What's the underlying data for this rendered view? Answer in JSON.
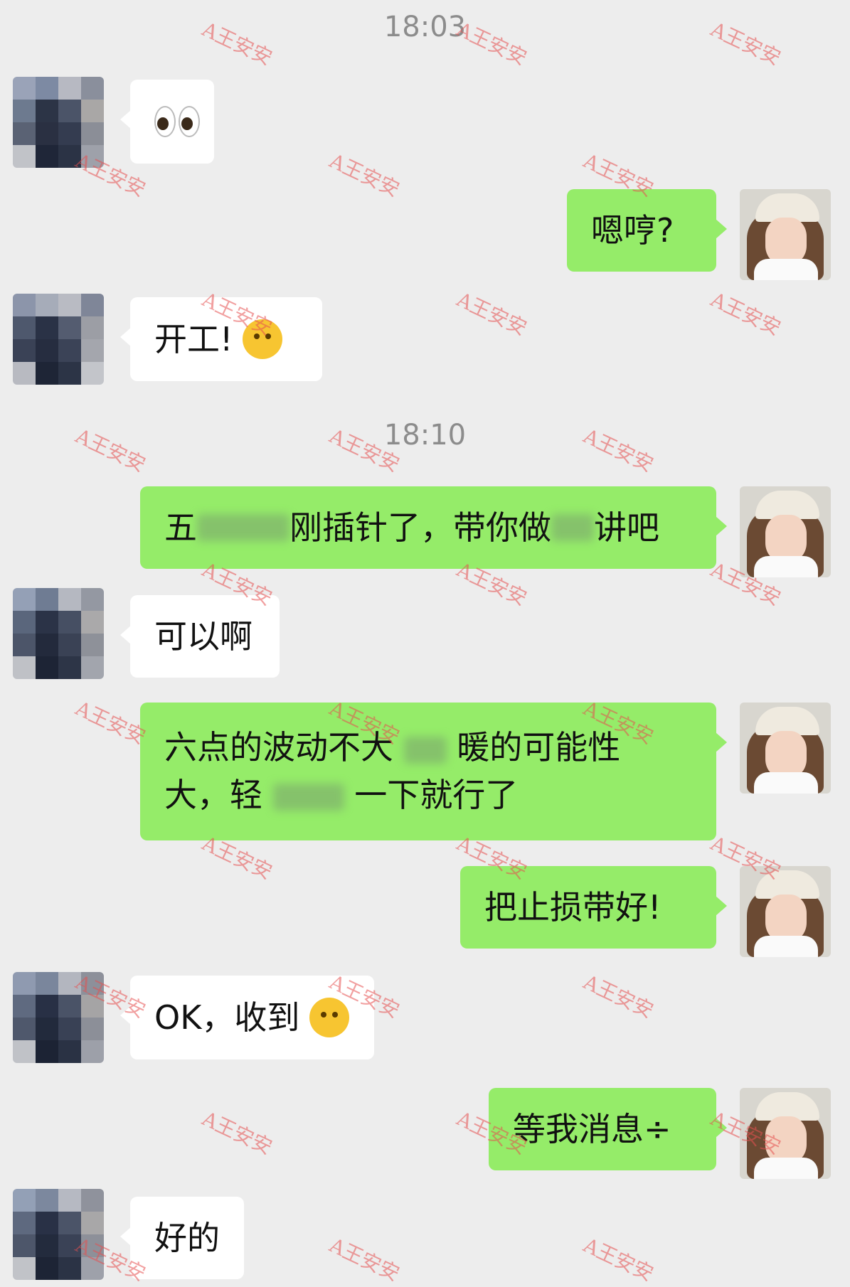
{
  "timestamps": [
    "18:03",
    "18:10"
  ],
  "watermark_text": "A王安安",
  "messages": [
    {
      "side": "in",
      "text": "",
      "icon": "eyes-emoji-icon"
    },
    {
      "side": "out",
      "text": "嗯哼?"
    },
    {
      "side": "in",
      "text": "开工!",
      "icon": "hand-over-mouth-emoji-icon"
    },
    {
      "side": "out",
      "text_a": "五",
      "text_b": "刚插针了，带你做",
      "text_c": "讲吧"
    },
    {
      "side": "in",
      "text": "可以啊"
    },
    {
      "side": "out",
      "line1_a": "六点的波动不大",
      "line1_b": "暖的可能性",
      "line2_a": "大，轻",
      "line2_b": "一下就行了"
    },
    {
      "side": "out",
      "text": "把止损带好!"
    },
    {
      "side": "in",
      "text": "OK，收到",
      "icon": "salute-emoji-icon"
    },
    {
      "side": "out",
      "text": "等我消息",
      "icon": "divide-icon"
    },
    {
      "side": "in",
      "text": "好的"
    }
  ],
  "colors": {
    "background": "#ededed",
    "outgoing_bubble": "#95ec69",
    "incoming_bubble": "#ffffff"
  }
}
